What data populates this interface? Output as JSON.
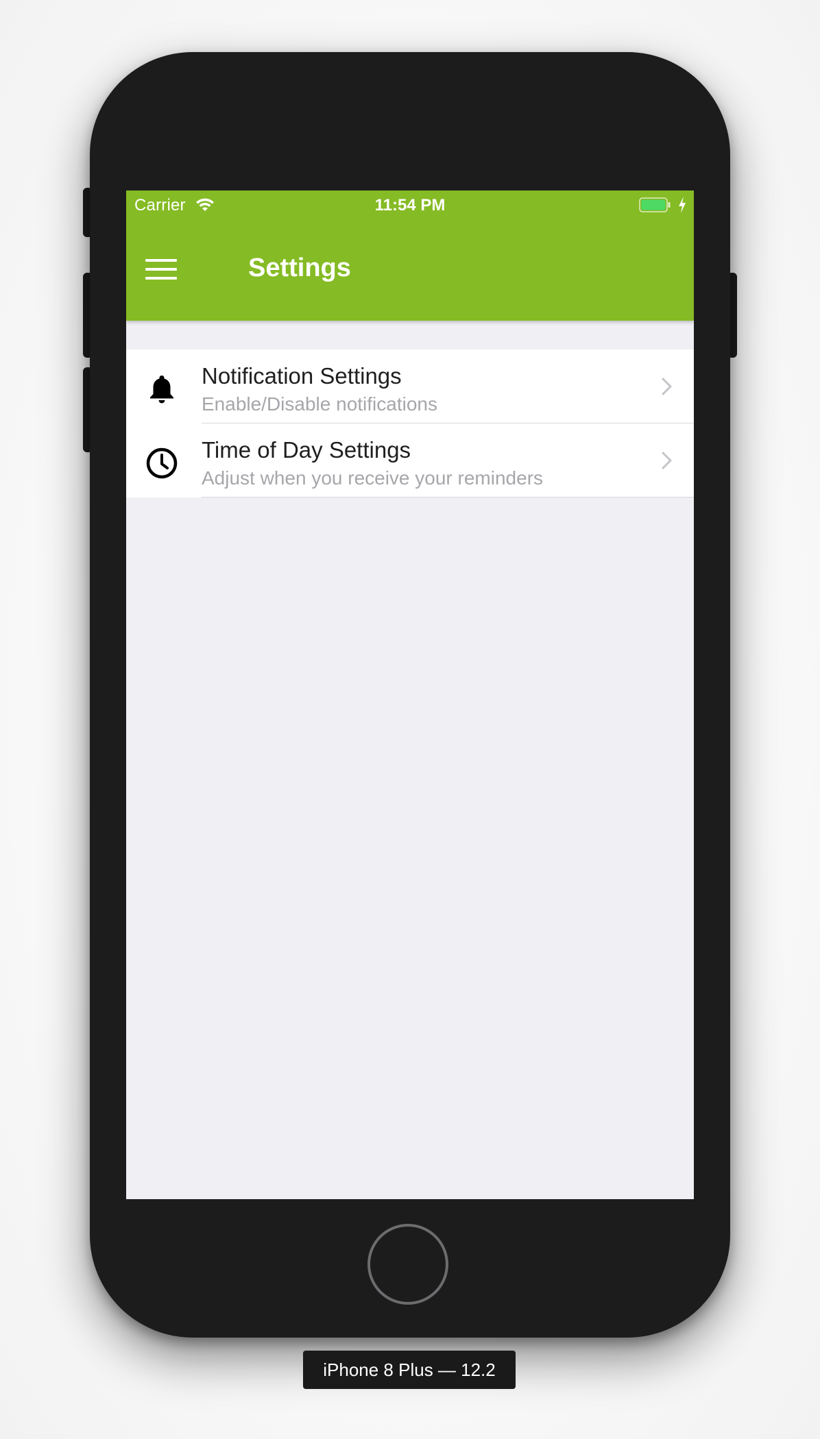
{
  "status_bar": {
    "carrier": "Carrier",
    "time": "11:54 PM",
    "wifi_icon": "wifi-icon",
    "battery_icon": "battery-icon",
    "charging_icon": "bolt-icon"
  },
  "nav_bar": {
    "title": "Settings",
    "menu_icon": "hamburger-menu-icon",
    "color": "#85bb24"
  },
  "settings_list": [
    {
      "icon": "bell-icon",
      "title": "Notification Settings",
      "subtitle": "Enable/Disable notifications"
    },
    {
      "icon": "clock-icon",
      "title": "Time of Day Settings",
      "subtitle": "Adjust when you receive your reminders"
    }
  ],
  "device_label": "iPhone 8 Plus — 12.2",
  "colors": {
    "accent": "#85bb24",
    "background": "#efeff4",
    "subtitle": "#a6a6ab"
  }
}
